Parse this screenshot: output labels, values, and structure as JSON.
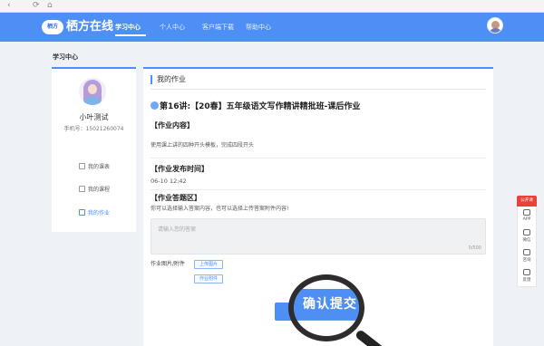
{
  "chrome": {
    "back": "‹",
    "refresh": "⟳",
    "home": "⌂"
  },
  "nav": {
    "logo_badge": "栖方",
    "logo_text": "栖方在线",
    "items": [
      "学习中心",
      "个人中心",
      "客户端下载",
      "帮助中心"
    ],
    "active_index": 0
  },
  "breadcrumb": "学习中心",
  "sidebar": {
    "name": "小叶测试",
    "phone": "手机号：15021260074",
    "items": [
      "我的课表",
      "我的课程",
      "我的作业"
    ],
    "active_index": 2
  },
  "main": {
    "section_title": "我的作业",
    "homework_title": "第16讲:【20春】五年级语文写作精讲精批班-课后作业",
    "content_label": "【作业内容】",
    "content_text": "使用课上讲的四种开头模板，完成四段开头",
    "publish_label": "【作业发布时间】",
    "publish_time": "06-10 12:42",
    "answer_label": "【作业答题区】",
    "answer_hint": "你可以选择输入答案内容，也可以选择上传答案附件内容!",
    "answer_placeholder": "请输入您的答案",
    "answer_count": "0/500",
    "attach_label": "作业图片/附件",
    "upload_image_btn": "上传图片",
    "attach_btn": "作业附件",
    "submit_btn": "确认提交"
  },
  "magnifier": {
    "zoom_text": "确认提交"
  },
  "float": {
    "top_label": "公开课",
    "items": [
      "APP",
      "微信",
      "咨询",
      "反馈"
    ]
  },
  "colors": {
    "primary": "#4d8ff5",
    "float_red": "#e8423a"
  }
}
